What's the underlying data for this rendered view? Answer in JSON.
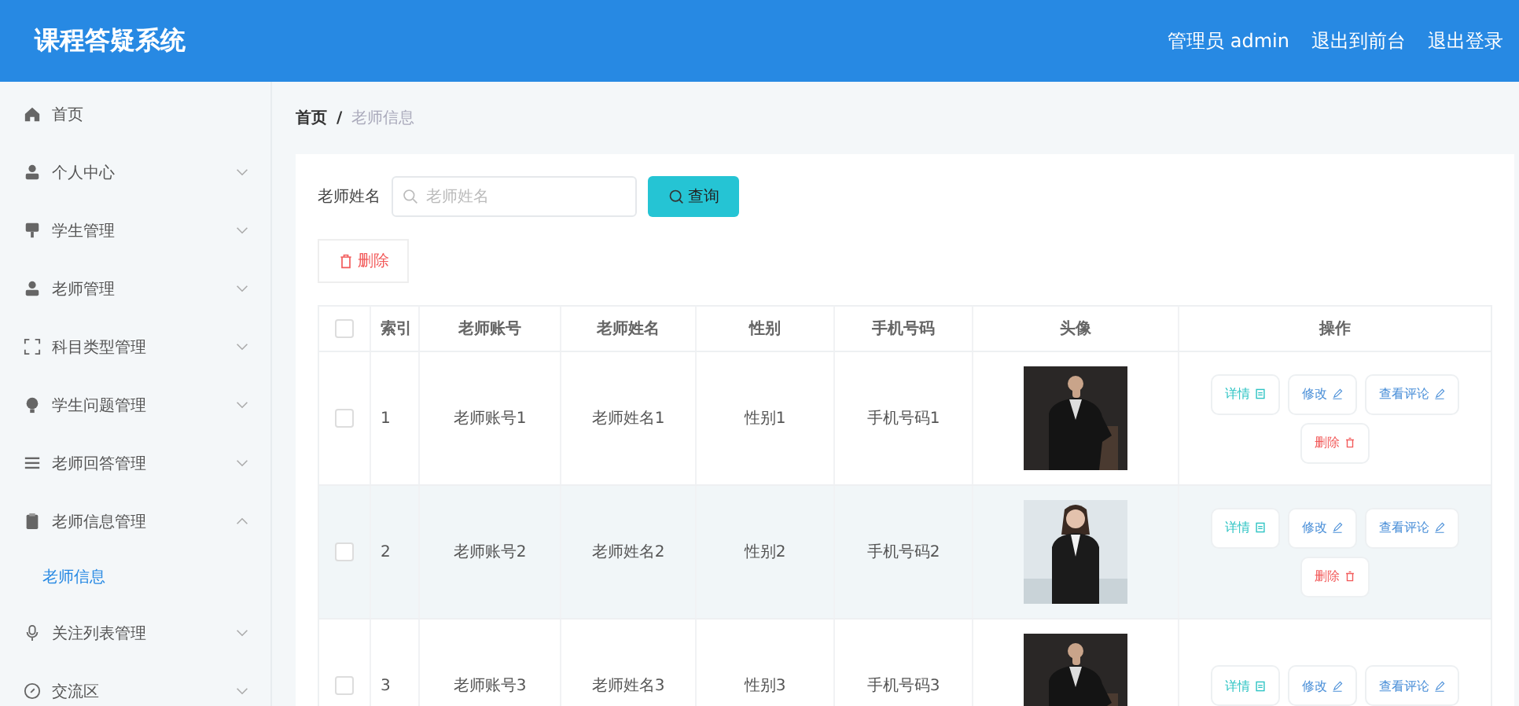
{
  "header": {
    "title": "课程答疑系统",
    "links": [
      "管理员 admin",
      "退出到前台",
      "退出登录"
    ]
  },
  "sidebar": {
    "items": [
      {
        "label": "首页",
        "has_arrow": false
      },
      {
        "label": "个人中心",
        "expanded": false,
        "has_arrow": true
      },
      {
        "label": "学生管理",
        "expanded": false,
        "has_arrow": true
      },
      {
        "label": "老师管理",
        "expanded": false,
        "has_arrow": true
      },
      {
        "label": "科目类型管理",
        "expanded": false,
        "has_arrow": true
      },
      {
        "label": "学生问题管理",
        "expanded": false,
        "has_arrow": true
      },
      {
        "label": "老师回答管理",
        "expanded": false,
        "has_arrow": true
      },
      {
        "label": "老师信息管理",
        "expanded": true,
        "has_arrow": true,
        "children": [
          {
            "label": "老师信息",
            "selected": true
          }
        ]
      },
      {
        "label": "关注列表管理",
        "expanded": false,
        "has_arrow": true
      },
      {
        "label": "交流区",
        "expanded": false,
        "has_arrow": true
      }
    ]
  },
  "breadcrumb": {
    "home": "首页",
    "separator": "/",
    "current": "老师信息"
  },
  "search": {
    "label": "老师姓名",
    "placeholder": "老师姓名",
    "button": "查询"
  },
  "delete_button": "删除",
  "table": {
    "all_checked": false,
    "columns": [
      "索引",
      "老师账号",
      "老师姓名",
      "性别",
      "手机号码",
      "头像",
      "操作"
    ],
    "rows": [
      {
        "checked": false,
        "highlighted": false,
        "cells": [
          "1",
          "老师账号1",
          "老师姓名1",
          "性别1",
          "手机号码1"
        ],
        "avatar": {
          "kind": "picture"
        },
        "actions": [
          {
            "kind": "detail",
            "label": "详情"
          },
          {
            "kind": "edit",
            "label": "修改"
          },
          {
            "kind": "edit",
            "label": "查看评论"
          },
          {
            "kind": "delete",
            "label": "删除"
          }
        ]
      },
      {
        "checked": false,
        "highlighted": true,
        "cells": [
          "2",
          "老师账号2",
          "老师姓名2",
          "性别2",
          "手机号码2"
        ],
        "avatar": {
          "kind": "picture"
        },
        "actions": [
          {
            "kind": "detail",
            "label": "详情"
          },
          {
            "kind": "edit",
            "label": "修改"
          },
          {
            "kind": "edit",
            "label": "查看评论"
          },
          {
            "kind": "delete",
            "label": "删除"
          }
        ]
      },
      {
        "checked": false,
        "highlighted": false,
        "cells": [
          "3",
          "老师账号3",
          "老师姓名3",
          "性别3",
          "手机号码3"
        ],
        "avatar": {
          "kind": "picture"
        },
        "actions": [
          {
            "kind": "detail",
            "label": "详情"
          },
          {
            "kind": "edit",
            "label": "修改"
          },
          {
            "kind": "edit",
            "label": "查看评论"
          }
        ]
      }
    ]
  }
}
